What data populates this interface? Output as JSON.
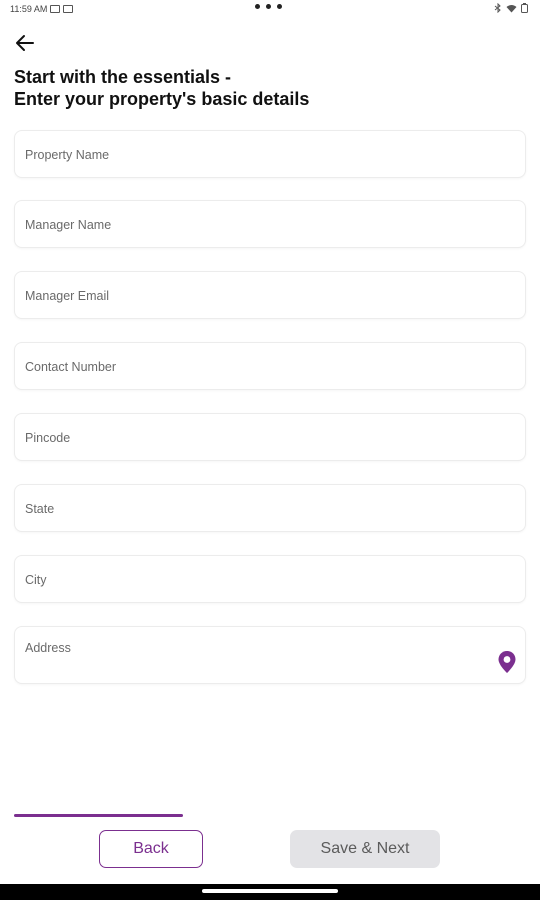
{
  "status_bar": {
    "time": "11:59 AM"
  },
  "header": {
    "title_line1": "Start with the essentials -",
    "title_line2": "Enter your property's basic details"
  },
  "form": {
    "property_name": "Property Name",
    "manager_name": "Manager Name",
    "manager_email": "Manager Email",
    "contact_number": "Contact Number",
    "pincode": "Pincode",
    "state": "State",
    "city": "City",
    "address": "Address"
  },
  "progress": {
    "fraction": 0.33
  },
  "buttons": {
    "back": "Back",
    "save_next": "Save & Next"
  },
  "colors": {
    "accent": "#7b2f8f",
    "disabled_bg": "#e3e3e6"
  },
  "icons": {
    "back": "arrow-left-icon",
    "location": "location-pin-icon"
  }
}
